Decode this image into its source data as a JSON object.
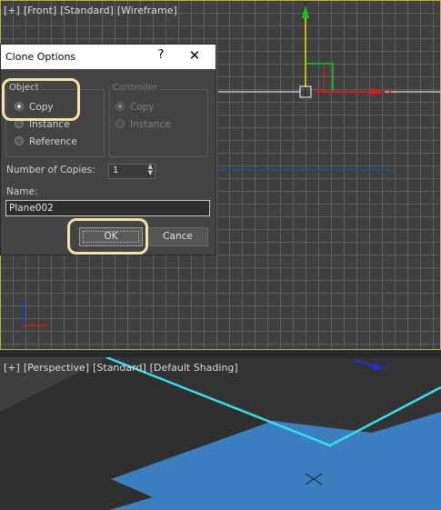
{
  "front_viewport": {
    "label_parts": [
      "[+]",
      "[Front]",
      "[Standard]",
      "[Wireframe]"
    ]
  },
  "dialog": {
    "title": "Clone Options",
    "help_glyph": "?",
    "close_glyph": "✕",
    "object_group": {
      "title": "Object",
      "options": [
        {
          "label": "Copy",
          "selected": true
        },
        {
          "label": "Instance",
          "selected": false
        },
        {
          "label": "Reference",
          "selected": false
        }
      ]
    },
    "controller_group": {
      "title": "Controller",
      "options": [
        {
          "label": "Copy",
          "selected": true
        },
        {
          "label": "Instance",
          "selected": false
        }
      ]
    },
    "copies_label": "Number of Copies:",
    "copies_value": "1",
    "name_label": "Name:",
    "name_value": "Plane002",
    "ok_label": "OK",
    "cancel_label": "Cance"
  },
  "perspective_viewport": {
    "label_parts": [
      "[+]",
      "[Perspective]",
      "[Standard]",
      "[Default Shading]"
    ],
    "axis_label": "z"
  },
  "colors": {
    "highlight": "#f5e4a8",
    "plane": "#3a80c0",
    "selection_edge": "#34e0f0",
    "axis_x": "#e01818",
    "axis_y": "#18c818",
    "axis_z": "#2030e0"
  }
}
